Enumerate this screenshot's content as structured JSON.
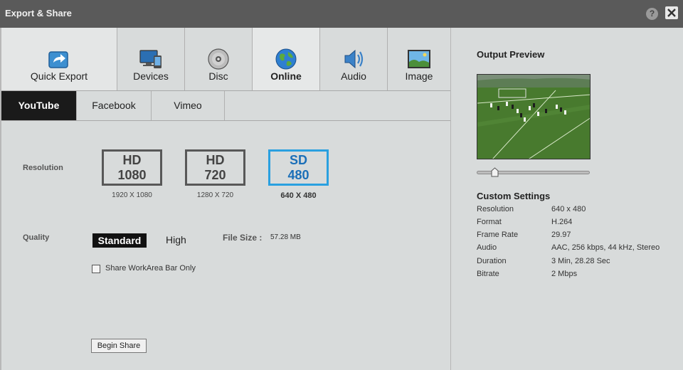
{
  "window": {
    "title": "Export & Share",
    "help_label": "?"
  },
  "tabs": [
    {
      "label": "Quick Export",
      "icon": "quick-export-icon"
    },
    {
      "label": "Devices",
      "icon": "devices-icon"
    },
    {
      "label": "Disc",
      "icon": "disc-icon"
    },
    {
      "label": "Online",
      "icon": "globe-icon",
      "active": true
    },
    {
      "label": "Audio",
      "icon": "speaker-icon"
    },
    {
      "label": "Image",
      "icon": "image-icon"
    }
  ],
  "subtabs": [
    {
      "label": "YouTube",
      "active": true
    },
    {
      "label": "Facebook"
    },
    {
      "label": "Vimeo"
    }
  ],
  "resolution": {
    "label": "Resolution",
    "options": [
      {
        "line1": "HD",
        "line2": "1080",
        "caption": "1920 X 1080"
      },
      {
        "line1": "HD",
        "line2": "720",
        "caption": "1280 X 720"
      },
      {
        "line1": "SD",
        "line2": "480",
        "caption": "640 X 480",
        "selected": true
      }
    ]
  },
  "quality": {
    "label": "Quality",
    "options": [
      "Standard",
      "High"
    ],
    "selected": "Standard",
    "file_size_label": "File Size :",
    "file_size_value": "57.28 MB"
  },
  "share_workarea": {
    "label": "Share WorkArea Bar Only",
    "checked": false
  },
  "begin_share_label": "Begin Share",
  "preview": {
    "title": "Output Preview"
  },
  "custom_settings": {
    "title": "Custom Settings",
    "rows": [
      {
        "key": "Resolution",
        "value": "640 x 480"
      },
      {
        "key": "Format",
        "value": "H.264"
      },
      {
        "key": "Frame Rate",
        "value": "29.97"
      },
      {
        "key": "Audio",
        "value": "AAC, 256 kbps, 44 kHz, Stereo"
      },
      {
        "key": "Duration",
        "value": "3 Min, 28.28 Sec"
      },
      {
        "key": "Bitrate",
        "value": "2 Mbps"
      }
    ]
  },
  "colors": {
    "selected_accent": "#2aa0e0",
    "active_subtab": "#1a1a1a"
  }
}
